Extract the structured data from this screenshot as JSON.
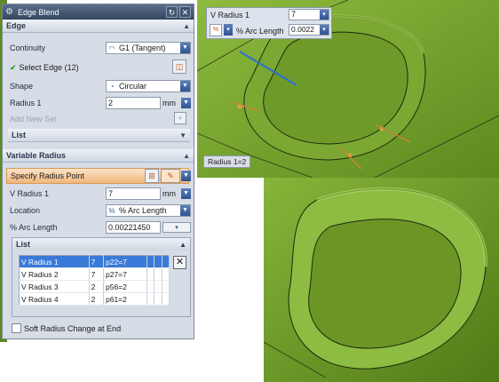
{
  "dialog": {
    "title": "Edge Blend",
    "edge_section": {
      "header": "Edge",
      "continuity_label": "Continuity",
      "continuity_value": "G1 (Tangent)",
      "select_edge_label": "Select Edge (12)",
      "shape_label": "Shape",
      "shape_value": "Circular",
      "radius_label": "Radius 1",
      "radius_value": "2",
      "radius_unit": "mm",
      "add_new_set_label": "Add New Set",
      "list_label": "List"
    },
    "variable_section": {
      "header": "Variable Radius",
      "specify_label": "Specify Radius Point",
      "v_radius_label": "V Radius 1",
      "v_radius_value": "7",
      "v_radius_unit": "mm",
      "location_label": "Location",
      "location_value": "% Arc Length",
      "arc_length_label": "% Arc Length",
      "arc_length_value": "0.00221450",
      "list_label": "List",
      "rows": [
        {
          "name": "V Radius 1",
          "value": "7",
          "expr": "p22=7",
          "selected": true
        },
        {
          "name": "V Radius 2",
          "value": "7",
          "expr": "p27=7",
          "selected": false
        },
        {
          "name": "V Radius 3",
          "value": "2",
          "expr": "p56=2",
          "selected": false
        },
        {
          "name": "V Radius 4",
          "value": "2",
          "expr": "p61=2",
          "selected": false
        }
      ]
    },
    "soft_radius_label": "Soft Radius Change at End"
  },
  "floating": {
    "v_radius_label": "V Radius 1",
    "v_radius_value": "7",
    "arc_label": "% Arc Length",
    "arc_value": "0.0022"
  },
  "viewport_tag": "Radius 1=2"
}
